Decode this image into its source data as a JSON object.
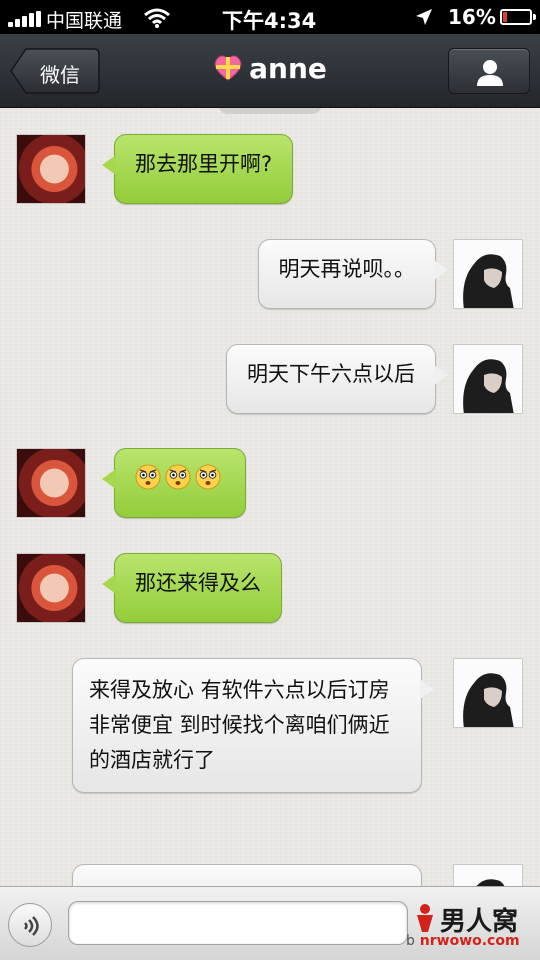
{
  "status_bar": {
    "carrier": "中国联通",
    "time": "下午4:34",
    "battery": "16%",
    "battery_level": 0.16
  },
  "nav": {
    "back_label": "微信",
    "title": "anne",
    "title_icon": "gift-heart-icon",
    "right_icon": "profile-icon"
  },
  "messages": [
    {
      "side": "left",
      "text": "那去那里开啊?"
    },
    {
      "side": "right",
      "text": "明天再说呗。。"
    },
    {
      "side": "right",
      "text": "明天下午六点以后"
    },
    {
      "side": "left",
      "text": "",
      "emoji": [
        "shocked-face",
        "shocked-face",
        "shocked-face"
      ]
    },
    {
      "side": "left",
      "text": "那还来得及么"
    },
    {
      "side": "right",
      "text": "来得及放心 有软件六点以后订房非常便宜 到时候找个离咱们俩近的酒店就行了"
    }
  ],
  "input_bar": {
    "voice_icon": "voice-icon",
    "placeholder": ""
  },
  "watermark": {
    "brand": "男人窝",
    "url": "nrwowo.com",
    "prefix": "b"
  },
  "colors": {
    "green_bubble": "#a6d84e",
    "gray_bubble": "#f0f0f0",
    "nav": "#2e3237",
    "battery_low": "#e03b2e"
  }
}
